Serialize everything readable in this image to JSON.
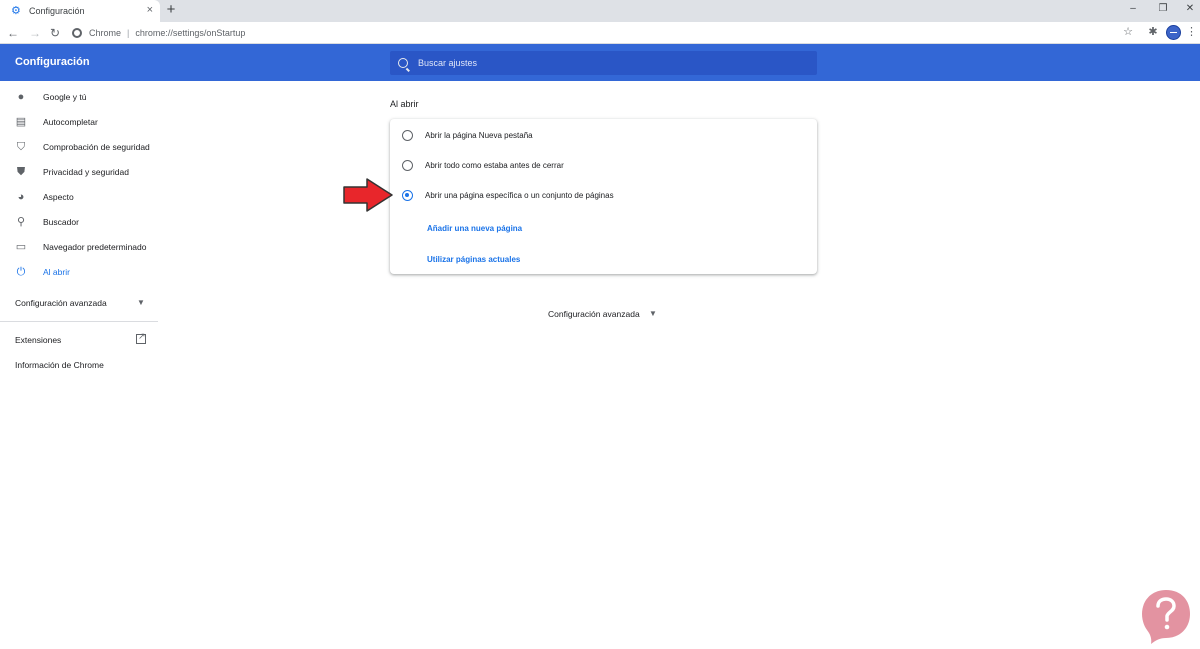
{
  "browser": {
    "tab_title": "Configuración",
    "site_label": "Chrome",
    "url": "chrome://settings/onStartup"
  },
  "header": {
    "title": "Configuración",
    "search_placeholder": "Buscar ajustes"
  },
  "sidebar": {
    "items": [
      {
        "label": "Google y tú",
        "icon": "person-icon"
      },
      {
        "label": "Autocompletar",
        "icon": "clipboard-icon"
      },
      {
        "label": "Comprobación de seguridad",
        "icon": "shield-check-icon"
      },
      {
        "label": "Privacidad y seguridad",
        "icon": "shield-icon"
      },
      {
        "label": "Aspecto",
        "icon": "palette-icon"
      },
      {
        "label": "Buscador",
        "icon": "search-icon"
      },
      {
        "label": "Navegador predeterminado",
        "icon": "browser-icon"
      },
      {
        "label": "Al abrir",
        "icon": "power-icon",
        "active": true
      }
    ],
    "advanced": "Configuración avanzada",
    "extensions": "Extensiones",
    "about": "Información de Chrome"
  },
  "main": {
    "section_title": "Al abrir",
    "options": [
      {
        "label": "Abrir la página Nueva pestaña",
        "checked": false
      },
      {
        "label": "Abrir todo como estaba antes de cerrar",
        "checked": false
      },
      {
        "label": "Abrir una página específica o un conjunto de páginas",
        "checked": true
      }
    ],
    "add_page_link": "Añadir una nueva página",
    "use_current_link": "Utilizar páginas actuales",
    "advanced": "Configuración avanzada"
  },
  "colors": {
    "header_blue": "#3367d6",
    "accent": "#1a73e8",
    "annotation_red": "#e8262b"
  }
}
